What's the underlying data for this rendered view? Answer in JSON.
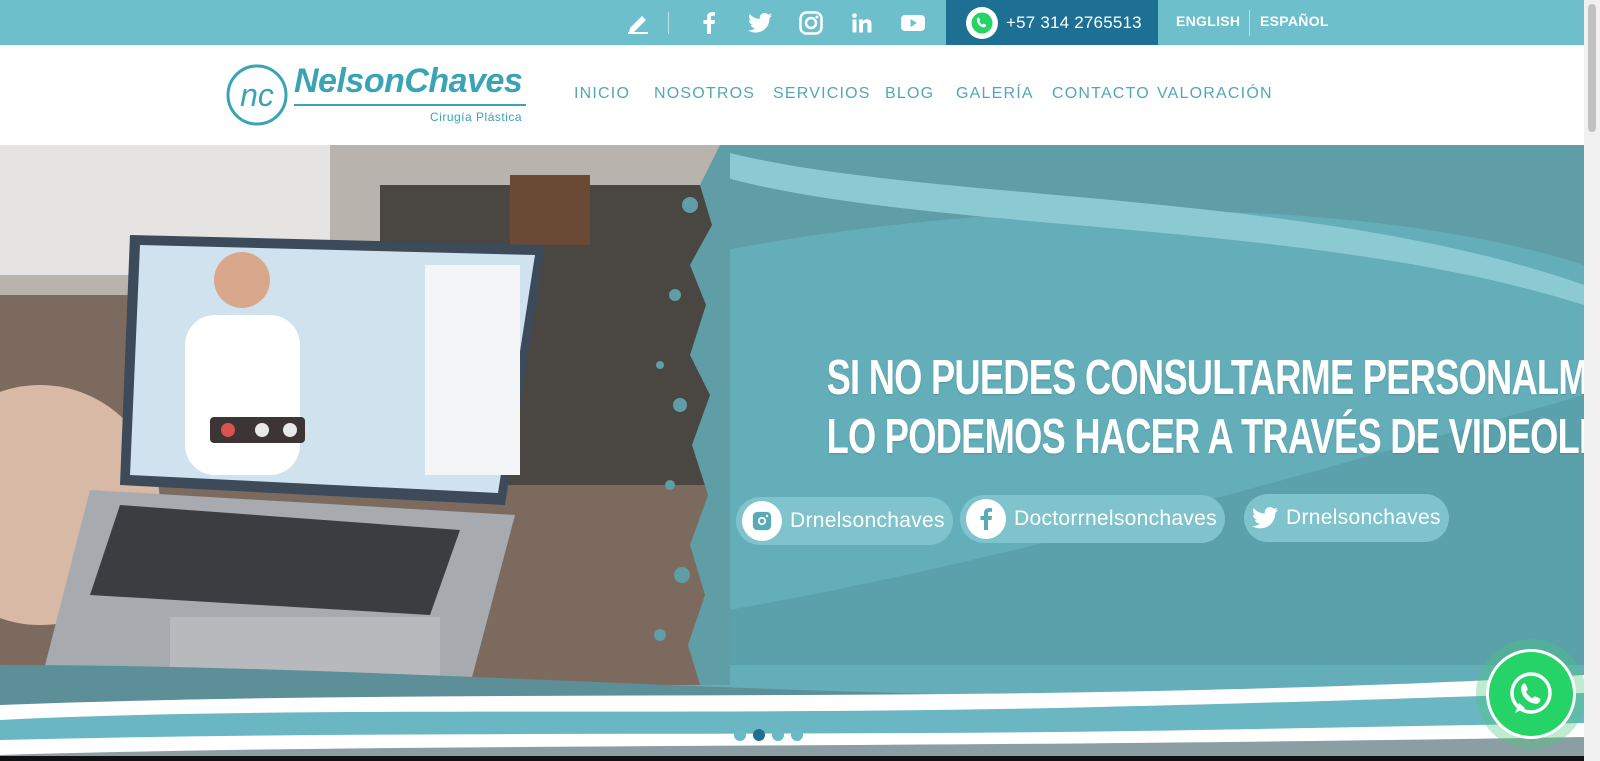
{
  "topbar": {
    "icons": [
      "pencil-icon",
      "facebook-icon",
      "twitter-icon",
      "instagram-icon",
      "linkedin-icon",
      "youtube-icon"
    ],
    "phone": "+57 314 2765513",
    "phone_icon": "whatsapp-icon",
    "lang_en": "ENGLISH",
    "lang_es": "ESPAÑOL"
  },
  "logo": {
    "monogram": "nc",
    "name": "NelsonChaves",
    "tagline": "Cirugía Plástica"
  },
  "nav": {
    "items": [
      "INICIO",
      "NOSOTROS",
      "SERVICIOS",
      "BLOG",
      "GALERÍA",
      "CONTACTO",
      "VALORACIÓN"
    ]
  },
  "hero": {
    "line1": "SI NO PUEDES CONSULTARME PERSONALMENTE",
    "line2": "LO PODEMOS HACER A TRAVÉS DE VIDEOLLAMADA",
    "socials": [
      {
        "icon": "instagram-icon",
        "handle": "Drnelsonchaves"
      },
      {
        "icon": "facebook-icon",
        "handle": "Doctorrnelsonchaves"
      },
      {
        "icon": "twitter-icon",
        "handle": "Drnelsonchaves"
      }
    ],
    "slides_total": 4,
    "slide_active": 2
  },
  "floating": {
    "icon": "whatsapp-icon"
  },
  "colors": {
    "topbar": "#6dbfcc",
    "phone_box": "#1d6f93",
    "brand": "#3aa4b6",
    "hero": "#66b0bb",
    "whatsapp": "#25d366"
  }
}
